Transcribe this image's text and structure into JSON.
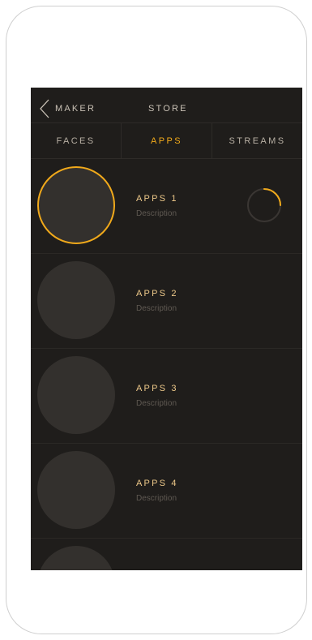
{
  "header": {
    "back_label": "MAKER",
    "title": "STORE",
    "back_icon": "chevron-left-icon"
  },
  "tabs": [
    {
      "label": "FACES",
      "active": false
    },
    {
      "label": "APPS",
      "active": true
    },
    {
      "label": "STREAMS",
      "active": false
    }
  ],
  "items": [
    {
      "title": "APPS 1",
      "description": "Description",
      "selected": true,
      "progress": 0.25
    },
    {
      "title": "APPS 2",
      "description": "Description",
      "selected": false
    },
    {
      "title": "APPS 3",
      "description": "Description",
      "selected": false
    },
    {
      "title": "APPS 4",
      "description": "Description",
      "selected": false
    },
    {
      "title": "",
      "description": "",
      "selected": false
    }
  ],
  "colors": {
    "accent": "#f0a91b",
    "background": "#1f1d1b",
    "thumb": "#33302d",
    "title_text": "#eec98a",
    "description_text": "#5f5952"
  }
}
